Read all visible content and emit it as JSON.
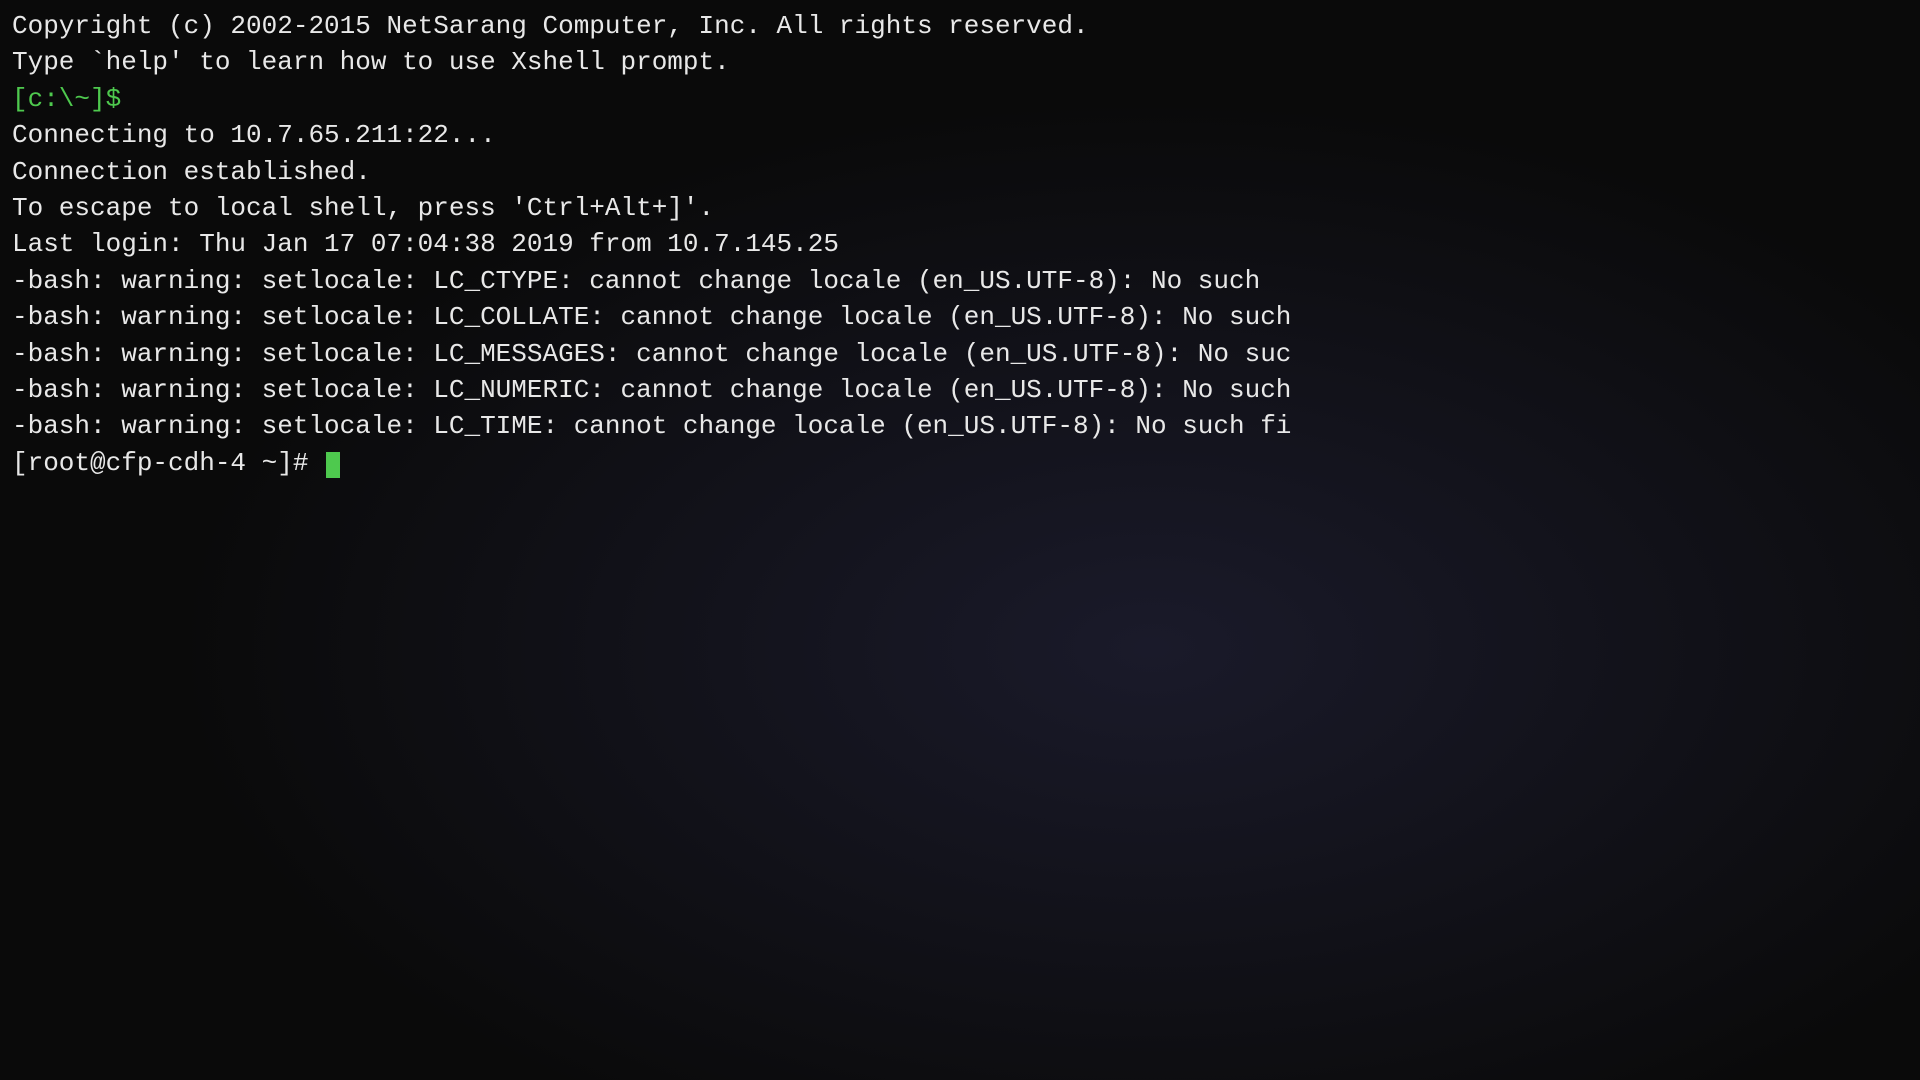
{
  "terminal": {
    "copyright": "Copyright (c) 2002-2015 NetSarang Computer, Inc. All rights reserved.",
    "blank1": "",
    "help_hint": "Type `help' to learn how to use Xshell prompt.",
    "local_prompt": "[c:\\~]$",
    "blank2": "",
    "connecting": "Connecting to 10.7.65.211:22...",
    "established": "Connection established.",
    "escape": "To escape to local shell, press 'Ctrl+Alt+]'.",
    "blank3": "",
    "last_login": "Last login: Thu Jan 17 07:04:38 2019 from 10.7.145.25",
    "warn_ctype": "-bash: warning: setlocale: LC_CTYPE: cannot change locale (en_US.UTF-8): No such ",
    "warn_collate": "-bash: warning: setlocale: LC_COLLATE: cannot change locale (en_US.UTF-8): No such",
    "warn_messages": "-bash: warning: setlocale: LC_MESSAGES: cannot change locale (en_US.UTF-8): No suc",
    "warn_numeric": "-bash: warning: setlocale: LC_NUMERIC: cannot change locale (en_US.UTF-8): No such",
    "warn_time": "-bash: warning: setlocale: LC_TIME: cannot change locale (en_US.UTF-8): No such fi",
    "remote_prompt": "[root@cfp-cdh-4 ~]# "
  }
}
